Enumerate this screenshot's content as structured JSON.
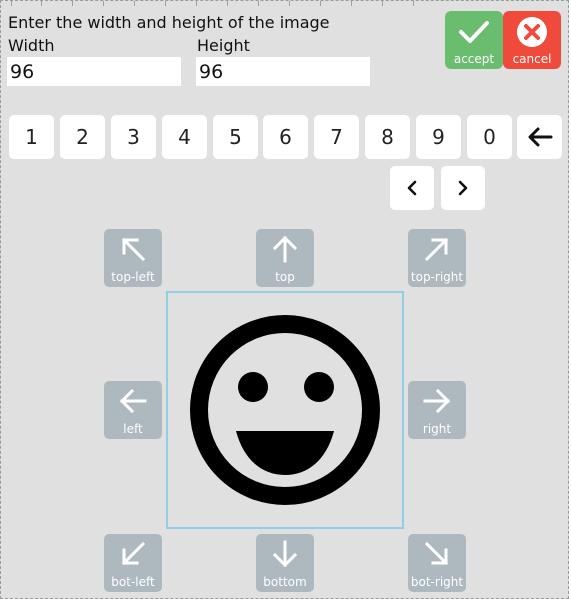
{
  "dialog": {
    "prompt": "Enter the width and height of the image",
    "width_label": "Width",
    "width_value": "96",
    "height_label": "Height",
    "height_value": "96",
    "accept_label": "accept",
    "cancel_label": "cancel"
  },
  "keypad": {
    "keys": [
      "1",
      "2",
      "3",
      "4",
      "5",
      "6",
      "7",
      "8",
      "9",
      "0"
    ],
    "backspace_icon": "arrow-left-icon",
    "prev_label": "<",
    "next_label": ">"
  },
  "anchors": {
    "top_left": "top-left",
    "top": "top",
    "top_right": "top-right",
    "left": "left",
    "right": "right",
    "bottom_left": "bot-left",
    "bottom": "bottom",
    "bottom_right": "bot-right"
  },
  "colors": {
    "accept": "#6abd6e",
    "cancel": "#f04a3c",
    "anchor_button": "#aeb9bf",
    "canvas_border": "#92cfe6"
  },
  "preview": {
    "icon": "smiley-face-icon"
  }
}
